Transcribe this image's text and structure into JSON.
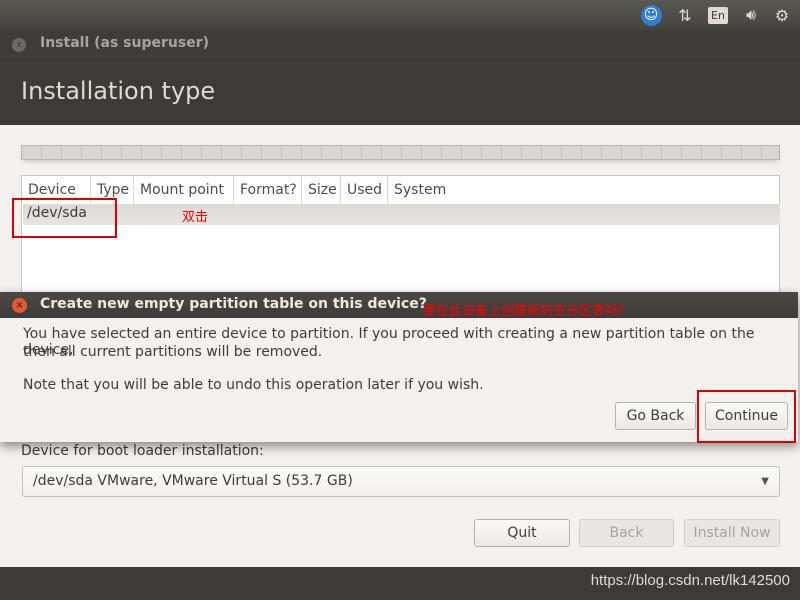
{
  "panel": {
    "icons": [
      "accessibility-icon",
      "network-icon",
      "keyboard-layout-icon",
      "volume-icon",
      "power-gear-icon"
    ],
    "keyboard_layout": "En"
  },
  "window": {
    "title": "Install (as superuser)",
    "close": "x",
    "heading": "Installation type"
  },
  "table": {
    "columns": [
      "Device",
      "Type",
      "Mount point",
      "Format?",
      "Size",
      "Used",
      "System"
    ],
    "rows": [
      {
        "device": "/dev/sda"
      }
    ]
  },
  "annotations": {
    "double_click": "双击",
    "dialog_note": "要在此设备上创建新的空分区表吗？"
  },
  "dialog": {
    "title": "Create new empty partition table on this device?",
    "line1": "You have selected an entire device to partition. If you proceed with creating a new partition table on the device,",
    "line2": "then all current partitions will be removed.",
    "line3": "Note that you will be able to undo this operation later if you wish.",
    "go_back": "Go Back",
    "continue": "Continue"
  },
  "boot": {
    "label": "Device for boot loader installation:",
    "value": "/dev/sda VMware, VMware Virtual S (53.7 GB)"
  },
  "buttons": {
    "quit": "Quit",
    "back": "Back",
    "install_now": "Install Now"
  },
  "watermark": "https://blog.csdn.net/lk142500",
  "colors": {
    "accent_red": "#ff0000",
    "panel": "#3c3b37",
    "accessibility": "#2f7fd1"
  }
}
